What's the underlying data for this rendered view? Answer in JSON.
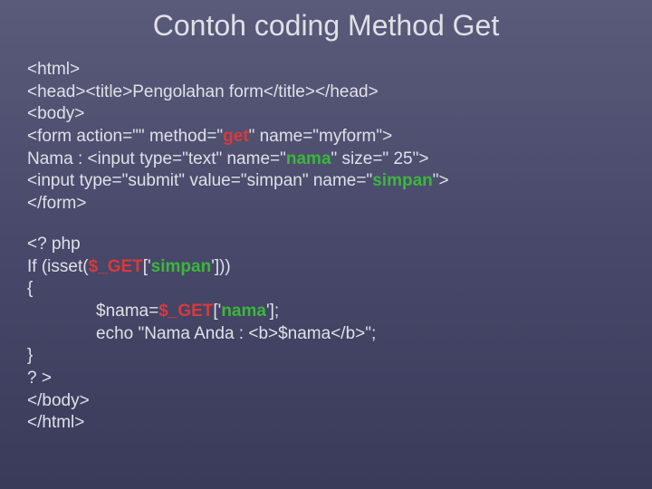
{
  "title": "Contoh coding Method Get",
  "lines": {
    "l1": "<html>",
    "l2": "<head><title>Pengolahan form</title></head>",
    "l3": "<body>",
    "l4a": "<form action=\"\" method=\"",
    "l4b": "get",
    "l4c": "\" name=\"myform\">",
    "l5a": "Nama : <input type=\"text\" name=\"",
    "l5b": "nama",
    "l5c": "\" size=\" 25\">",
    "l6a": "<input type=\"submit\" value=\"simpan\" name=\"",
    "l6b": "simpan",
    "l6c": "\">",
    "l7": "</form>",
    "p1": "<? php",
    "p2a": "If (isset(",
    "p2b": "$_GET",
    "p2c": "['",
    "p2d": "simpan",
    "p2e": "']))",
    "p3": "{",
    "p4a": "$nama=",
    "p4b": "$_GET",
    "p4c": "['",
    "p4d": "nama",
    "p4e": "'];",
    "p5": "echo \"Nama Anda : <b>$nama</b>\";",
    "p6": "}",
    "p7": "? >",
    "p8": "</body>",
    "p9": "</html>"
  }
}
